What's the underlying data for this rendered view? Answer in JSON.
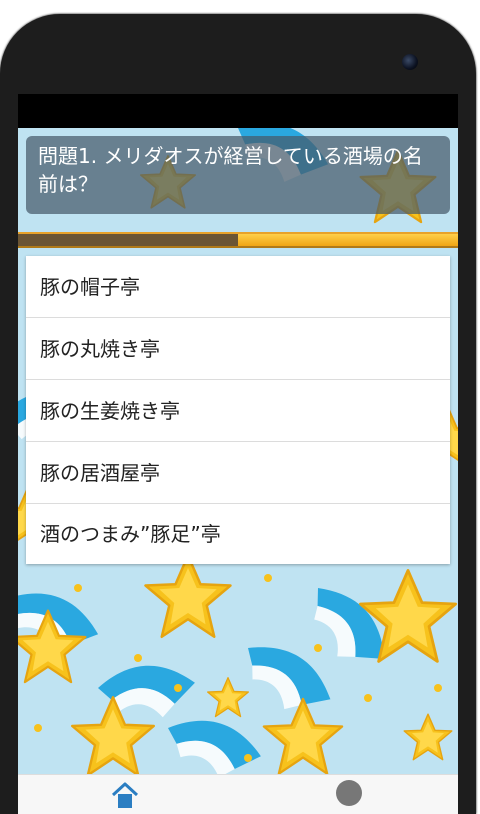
{
  "question": {
    "text": "問題1. メリダオスが経営している酒場の名前は？"
  },
  "progress": {
    "fraction": 0.5
  },
  "answers": [
    {
      "label": "豚の帽子亭"
    },
    {
      "label": "豚の丸焼き亭"
    },
    {
      "label": "豚の生姜焼き亭"
    },
    {
      "label": "豚の居酒屋亭"
    },
    {
      "label": "酒のつまみ”豚足”亭"
    }
  ],
  "bottom_nav": {
    "icons": [
      "home-icon",
      "profile-icon"
    ]
  },
  "colors": {
    "background": "#bfe3f2",
    "star": "#f7c21c",
    "streak": "#2aa8e0",
    "question_overlay": "#465a69",
    "progress_fill": "#f0a514"
  }
}
